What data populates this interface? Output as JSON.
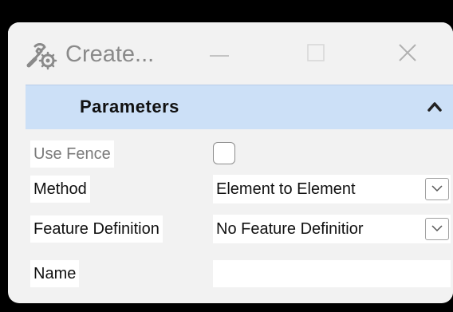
{
  "window": {
    "title": "Create...",
    "app_icon": "gear-wrench-icon",
    "controls": {
      "minimize_icon": "minimize-icon",
      "maximize_icon": "maximize-icon",
      "close_icon": "close-icon"
    }
  },
  "section": {
    "title": "Parameters",
    "collapse_icon": "chevron-up-icon",
    "accent_color": "#cce0f7"
  },
  "fields": {
    "use_fence": {
      "label": "Use Fence",
      "checked": false
    },
    "method": {
      "label": "Method",
      "value": "Element to Element"
    },
    "feature_definition": {
      "label": "Feature Definition",
      "value": "No Feature Definitior"
    },
    "name": {
      "label": "Name",
      "value": ""
    }
  }
}
